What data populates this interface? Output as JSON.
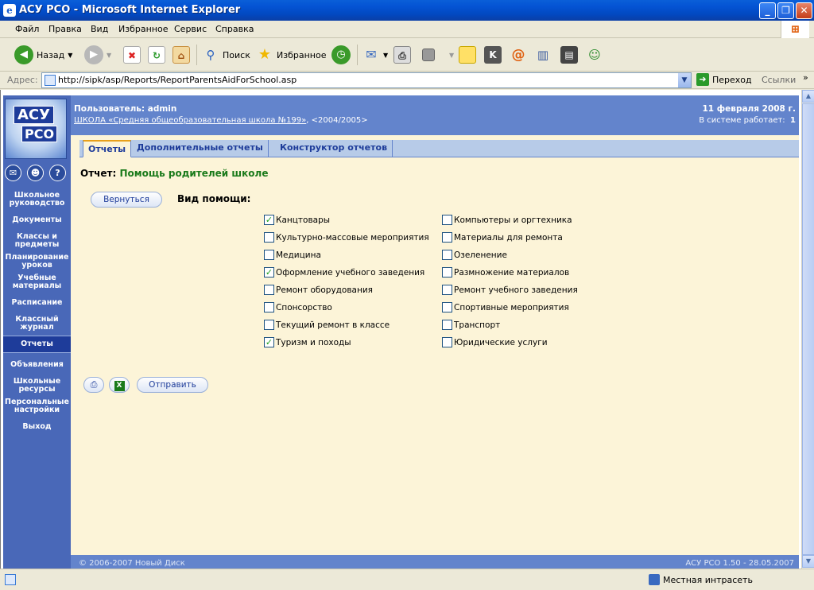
{
  "window": {
    "title": "АСУ РСО - Microsoft Internet Explorer"
  },
  "menu": [
    "Файл",
    "Правка",
    "Вид",
    "Избранное",
    "Сервис",
    "Справка"
  ],
  "toolbar": {
    "back": "Назад",
    "search": "Поиск",
    "favorites": "Избранное"
  },
  "address": {
    "label": "Адрес:",
    "url": "http://sipk/asp/Reports/ReportParentsAidForSchool.asp",
    "go": "Переход",
    "links": "Ссылки"
  },
  "logo": {
    "line1": "АСУ",
    "line2": "РСО"
  },
  "header": {
    "user": "Пользователь: admin",
    "school": "ШКОЛА «Средняя общеобразовательная школа №199»",
    "years": ", <2004/2005>",
    "date": "11 февраля 2008 г.",
    "online_label": "В системе работает:",
    "online_count": "1"
  },
  "sidebar": [
    "Школьное руководство",
    "Документы",
    "Классы и предметы",
    "Планирование уроков",
    "Учебные материалы",
    "Расписание",
    "Классный журнал",
    "Отчеты",
    "Объявления",
    "Школьные ресурсы",
    "Персональные настройки",
    "Выход"
  ],
  "sidebar_active": "Отчеты",
  "tabs": [
    "Отчеты",
    "Дополнительные отчеты",
    "Конструктор отчетов"
  ],
  "active_tab": "Отчеты",
  "report": {
    "label": "Отчет:",
    "name": "Помощь родителей школе"
  },
  "buttons": {
    "back": "Вернуться",
    "send": "Отправить"
  },
  "help_type_label": "Вид помощи:",
  "options_left": [
    {
      "label": "Канцтовары",
      "checked": true
    },
    {
      "label": "Культурно-массовые мероприятия",
      "checked": false
    },
    {
      "label": "Медицина",
      "checked": false
    },
    {
      "label": "Оформление учебного заведения",
      "checked": true
    },
    {
      "label": "Ремонт оборудования",
      "checked": false
    },
    {
      "label": "Спонсорство",
      "checked": false
    },
    {
      "label": "Текущий ремонт в классе",
      "checked": false
    },
    {
      "label": "Туризм и походы",
      "checked": true
    }
  ],
  "options_right": [
    {
      "label": "Компьютеры и оргтехника",
      "checked": false
    },
    {
      "label": "Материалы для ремонта",
      "checked": false
    },
    {
      "label": "Озеленение",
      "checked": false
    },
    {
      "label": "Размножение материалов",
      "checked": false
    },
    {
      "label": "Ремонт учебного заведения",
      "checked": false
    },
    {
      "label": "Спортивные мероприятия",
      "checked": false
    },
    {
      "label": "Транспорт",
      "checked": false
    },
    {
      "label": "Юридические услуги",
      "checked": false
    }
  ],
  "footer": {
    "left": "© 2006-2007 Новый Диск",
    "right": "АСУ РСО 1.50 - 28.05.2007"
  },
  "status": {
    "zone": "Местная интрасеть"
  }
}
